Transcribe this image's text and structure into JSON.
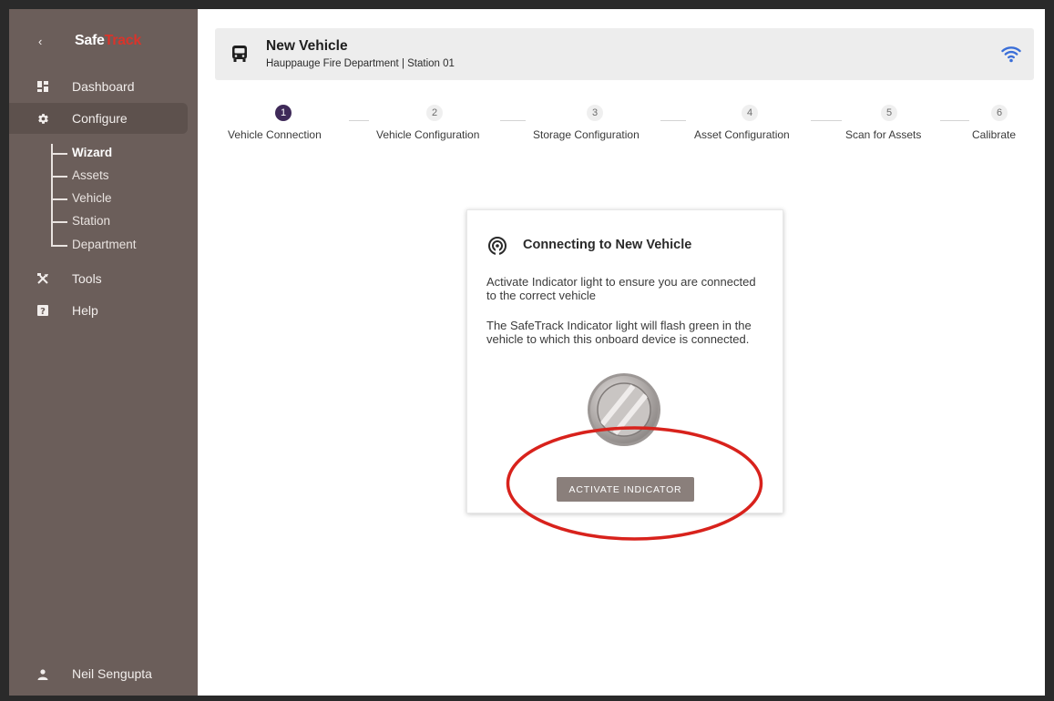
{
  "sidebar": {
    "back_icon": "chevron-left-icon",
    "logo": {
      "part1": "Safe",
      "part2": "Track"
    },
    "items": [
      {
        "label": "Dashboard",
        "icon": "dashboard-icon"
      },
      {
        "label": "Configure",
        "icon": "gear-icon"
      },
      {
        "label": "Tools",
        "icon": "tools-icon"
      },
      {
        "label": "Help",
        "icon": "help-icon"
      }
    ],
    "configure_sub": [
      "Wizard",
      "Assets",
      "Vehicle",
      "Station",
      "Department"
    ],
    "user": {
      "name": "Neil Sengupta",
      "icon": "user-icon"
    }
  },
  "header": {
    "icon": "bus-icon",
    "title": "New Vehicle",
    "subtitle": "Hauppauge Fire Department | Station 01",
    "status_icon": "wifi-icon"
  },
  "stepper": {
    "current_step": 1,
    "steps": [
      {
        "number": "1",
        "label": "Vehicle Connection"
      },
      {
        "number": "2",
        "label": "Vehicle Configuration"
      },
      {
        "number": "3",
        "label": "Storage Configuration"
      },
      {
        "number": "4",
        "label": "Asset Configuration"
      },
      {
        "number": "5",
        "label": "Scan for Assets"
      },
      {
        "number": "6",
        "label": "Calibrate"
      }
    ]
  },
  "card": {
    "icon": "broadcast-icon",
    "title": "Connecting to New Vehicle",
    "paragraph1": "Activate Indicator light to ensure you are connected to the correct vehicle",
    "paragraph2": "The SafeTrack Indicator light will flash green in the vehicle to which this onboard device is connected.",
    "indicator_icon": "indicator-light-icon",
    "button_label": "ACTIVATE INDICATOR"
  },
  "colors": {
    "sidebar_bg": "#6b5e5a",
    "step_active": "#3f2a59",
    "button_bg": "#8a7f7b",
    "annotation_red": "#d8221c",
    "wifi_blue": "#3b6fd8"
  }
}
